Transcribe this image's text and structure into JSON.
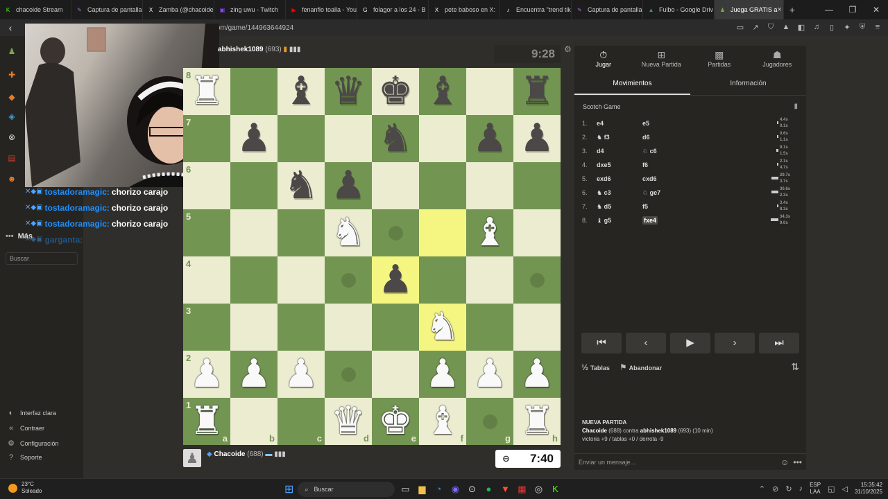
{
  "browser": {
    "tabs": [
      {
        "label": "chacoide Stream",
        "icon": "kick-icon",
        "color": "#53fc18"
      },
      {
        "label": "Captura de pantalla",
        "icon": "brush-icon",
        "color": "#b36bd8"
      },
      {
        "label": "Zamba (@chacoide)",
        "icon": "x-icon",
        "color": "#ffffff"
      },
      {
        "label": "zing uwu - Twitch",
        "icon": "twitch-icon",
        "color": "#9146ff"
      },
      {
        "label": "fenanflo toalla - You",
        "icon": "youtube-icon",
        "color": "#ff0000"
      },
      {
        "label": "folagor a los 24 - B",
        "icon": "google-icon",
        "color": "#ffffff"
      },
      {
        "label": "pete baboso en X:",
        "icon": "x-icon",
        "color": "#ffffff"
      },
      {
        "label": "Encuentra \"trend tik",
        "icon": "tiktok-icon",
        "color": "#ffffff"
      },
      {
        "label": "Captura de pantalla",
        "icon": "brush-icon",
        "color": "#b36bd8"
      },
      {
        "label": "Fulbo - Google Driv",
        "icon": "drive-icon",
        "color": "#34a853"
      },
      {
        "label": "Juega GRATIS a",
        "icon": "chess-icon",
        "color": "#7fa650",
        "active": true
      }
    ],
    "url": "om/game/144963644924"
  },
  "side": {
    "mas": "Más",
    "search_placeholder": "Buscar",
    "bottom": [
      "Interfaz clara",
      "Contraer",
      "Configuración",
      "Soporte"
    ]
  },
  "chat": [
    {
      "name": "tostadoramagic:",
      "text": "chorizo carajo"
    },
    {
      "name": "tostadoramagic:",
      "text": "chorizo carajo"
    },
    {
      "name": "tostadoramagic:",
      "text": "chorizo carajo"
    },
    {
      "name": "garganta:",
      "text": ""
    }
  ],
  "game": {
    "opponent": "abhishek1089",
    "opponent_rating": "(693)",
    "opponent_clock": "9:28",
    "me": "Chacoide",
    "me_rating": "(688)",
    "my_clock": "7:40",
    "board": [
      [
        "wR",
        "",
        "bB",
        "bQ",
        "bK",
        "bB",
        "",
        "bR"
      ],
      [
        "",
        "bP",
        "",
        "",
        "bN",
        "",
        "bP",
        "bP"
      ],
      [
        "",
        "",
        "bN",
        "bP",
        "",
        "",
        "",
        ""
      ],
      [
        "",
        "",
        "",
        "wN",
        "",
        "",
        "wB",
        ""
      ],
      [
        "",
        "",
        "",
        "",
        "bP",
        "",
        "",
        ""
      ],
      [
        "",
        "",
        "",
        "",
        "",
        "wN",
        "",
        ""
      ],
      [
        "wP",
        "wP",
        "wP",
        "",
        "",
        "wP",
        "wP",
        "wP"
      ],
      [
        "wR",
        "",
        "",
        "wQ",
        "wK",
        "wB",
        "",
        "wR"
      ]
    ],
    "highlights": [
      "f5",
      "e4",
      "f3"
    ],
    "dots": [
      "e5",
      "d4",
      "h4",
      "d2",
      "g1"
    ],
    "ranks": [
      "8",
      "7",
      "6",
      "5",
      "4",
      "3",
      "2",
      "1"
    ],
    "files": [
      "a",
      "b",
      "c",
      "d",
      "e",
      "f",
      "g",
      "h"
    ]
  },
  "panel": {
    "tabs": [
      {
        "label": "Jugar",
        "icon": "stopwatch-icon"
      },
      {
        "label": "Nueva Partida",
        "icon": "plus-icon"
      },
      {
        "label": "Partidas",
        "icon": "board-icon"
      },
      {
        "label": "Jugadores",
        "icon": "players-icon"
      }
    ],
    "subtabs": [
      "Movimientos",
      "Información"
    ],
    "opening": "Scotch Game",
    "moves": [
      {
        "n": "1.",
        "w": "e4",
        "b": "e5",
        "tw": "4.4s",
        "tb": "0.1s"
      },
      {
        "n": "2.",
        "w": "♞ f3",
        "b": "d6",
        "tw": "0.6s",
        "tb": "1.1s"
      },
      {
        "n": "3.",
        "w": "d4",
        "b": "♘ c6",
        "tw": "9.1s",
        "tb": "1.5s"
      },
      {
        "n": "4.",
        "w": "dxe5",
        "b": "f6",
        "tw": "2.1s",
        "tb": "4.7s"
      },
      {
        "n": "5.",
        "w": "exd6",
        "b": "cxd6",
        "tw": "29.7s",
        "tb": "3.7s"
      },
      {
        "n": "6.",
        "w": "♞ c3",
        "b": "♘ ge7",
        "tw": "30.6s",
        "tb": "2.3s"
      },
      {
        "n": "7.",
        "w": "♞ d5",
        "b": "f5",
        "tw": "3.4s",
        "tb": "8.3s"
      },
      {
        "n": "8.",
        "w": "♝ g5",
        "b": "fxe4",
        "tw": "34.3s",
        "tb": "9.0s"
      }
    ],
    "draw": "Tablas",
    "resign": "Abandonar",
    "newgame": {
      "header": "NUEVA PARTIDA",
      "white": "Chacoide",
      "white_rating": "(688)",
      "contra": "contra",
      "black": "abhishek1089",
      "black_rating": "(693)",
      "control": "(10 min)",
      "stats": "victoria +9 / tablas +0 / derrota -9"
    },
    "message_placeholder": "Enviar un mensaje..."
  },
  "taskbar": {
    "temp": "23°C",
    "weather": "Soleado",
    "search": "Buscar",
    "lang1": "ESP",
    "lang2": "LAA",
    "time": "15:35:42",
    "date": "31/10/2025"
  }
}
